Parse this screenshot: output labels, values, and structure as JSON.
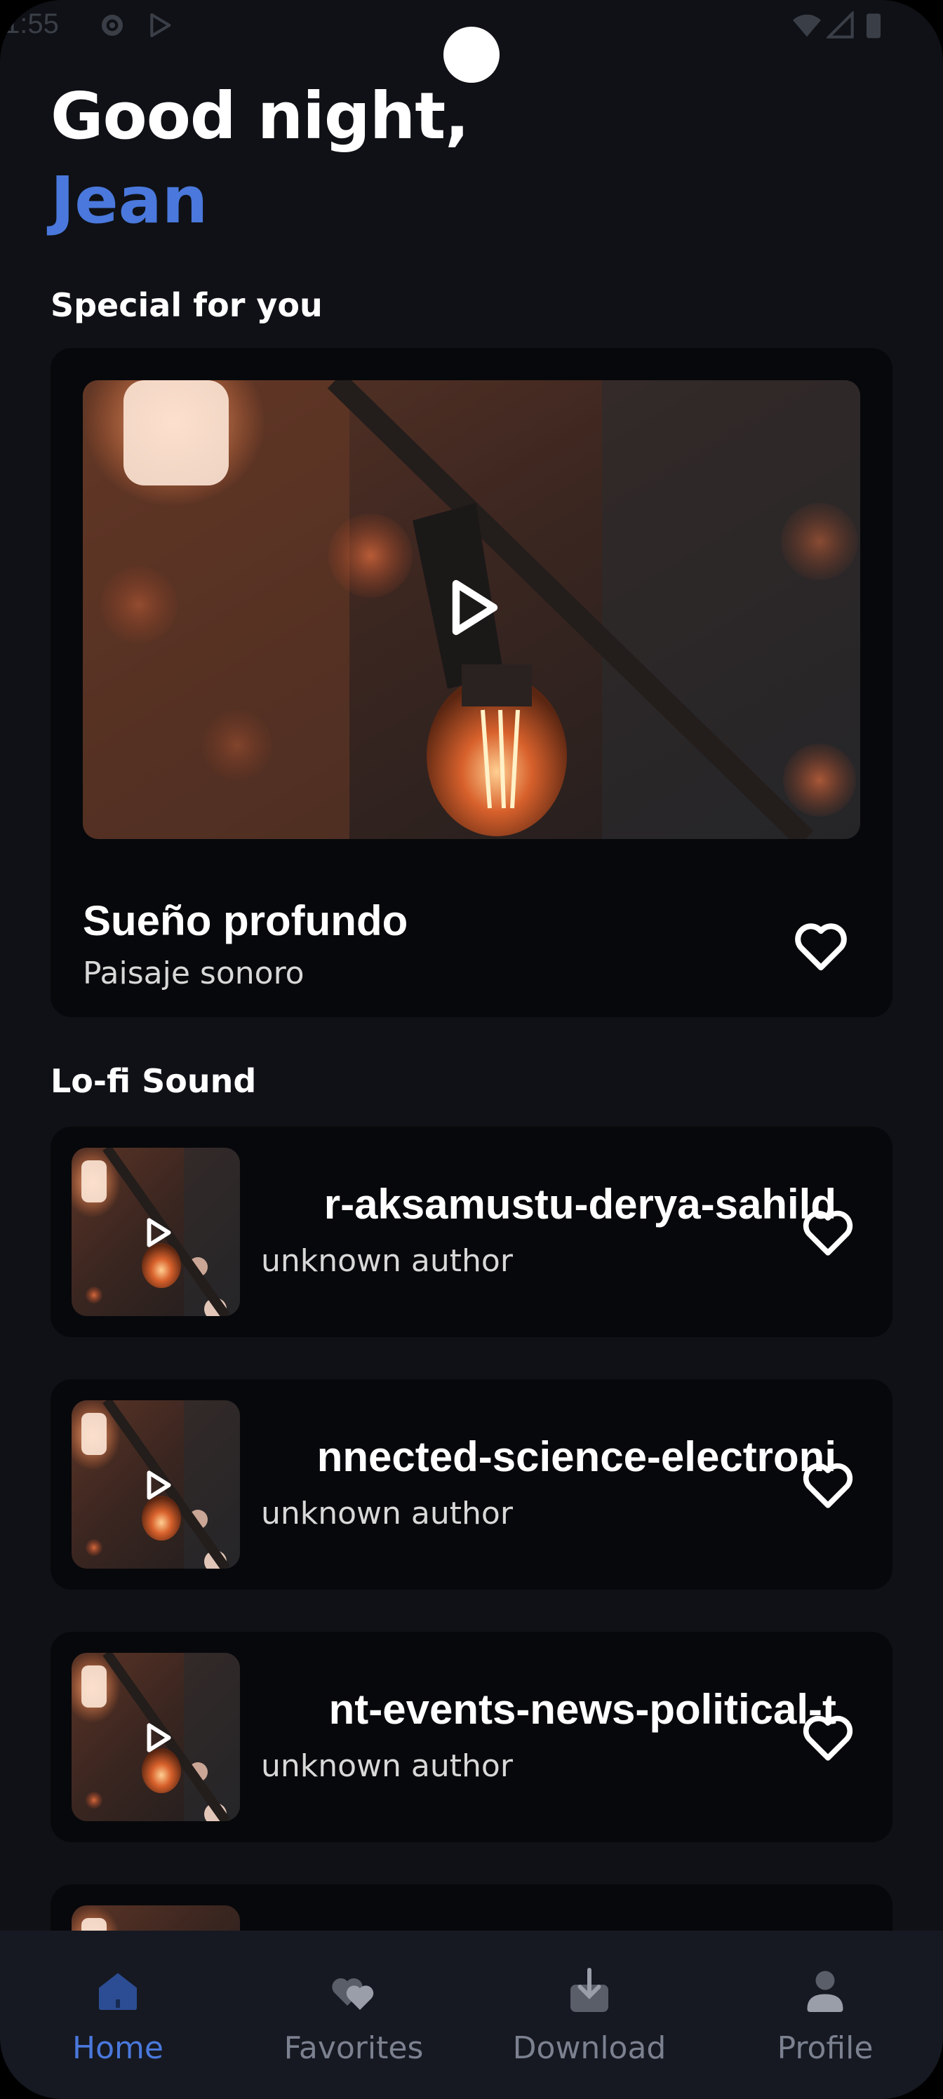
{
  "status_bar": {
    "time": "1:55"
  },
  "greeting": {
    "line1": "Good night,",
    "name": "Jean"
  },
  "sections": {
    "special": "Special for you",
    "lofi": "Lo-fi Sound"
  },
  "featured": {
    "title": "Sueño profundo",
    "subtitle": "Paisaje sonoro"
  },
  "tracks": [
    {
      "title": "r-aksamustu-derya-sahild",
      "author": "unknown author"
    },
    {
      "title": "nnected-science-electroni",
      "author": "unknown author"
    },
    {
      "title": "nt-events-news-political-t",
      "author": "unknown author"
    }
  ],
  "nav": [
    {
      "label": "Home",
      "icon": "home-icon",
      "active": true
    },
    {
      "label": "Favorites",
      "icon": "favorites-icon",
      "active": false
    },
    {
      "label": "Download",
      "icon": "download-icon",
      "active": false
    },
    {
      "label": "Profile",
      "icon": "profile-icon",
      "active": false
    }
  ],
  "colors": {
    "accent": "#4a78dc",
    "background": "#0f1116",
    "card": "#07080b",
    "nav_bg": "#161922",
    "nav_inactive": "#7c8190"
  }
}
